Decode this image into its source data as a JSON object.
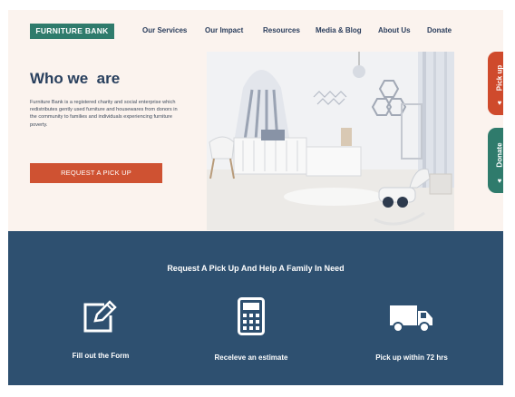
{
  "header": {
    "logo_text": "FURNITURE BANK",
    "nav": [
      "Our Services",
      "Our Impact",
      "Resources",
      "Media & Blog",
      "About Us",
      "Donate"
    ]
  },
  "hero": {
    "title": "Who we  are",
    "description": "Furniture Bank is a registered charity and social enterprise which redistributes gently used furniture and housewares from donors in the community to families and individuals experiencing furniture poverty.",
    "cta_label": "REQUEST A PICK UP"
  },
  "side_tabs": {
    "pickup_label": "Pick up",
    "donate_label": "Donate"
  },
  "steps_section": {
    "title": "Request A Pick Up And Help A Family In Need",
    "steps": [
      {
        "label": "Fill out the Form",
        "icon": "edit-form-icon"
      },
      {
        "label": "Receleve an estimate",
        "icon": "calculator-icon"
      },
      {
        "label": "Pick up within 72 hrs",
        "icon": "truck-icon"
      }
    ]
  },
  "colors": {
    "logo_bg": "#2f7b6c",
    "nav_text": "#2a3d5c",
    "cta_bg": "#cf5232",
    "pickup_tab": "#cf4a2c",
    "donate_tab": "#2f7b6c",
    "band_bg": "#2e5070",
    "hero_bg": "#fbf3ee"
  }
}
